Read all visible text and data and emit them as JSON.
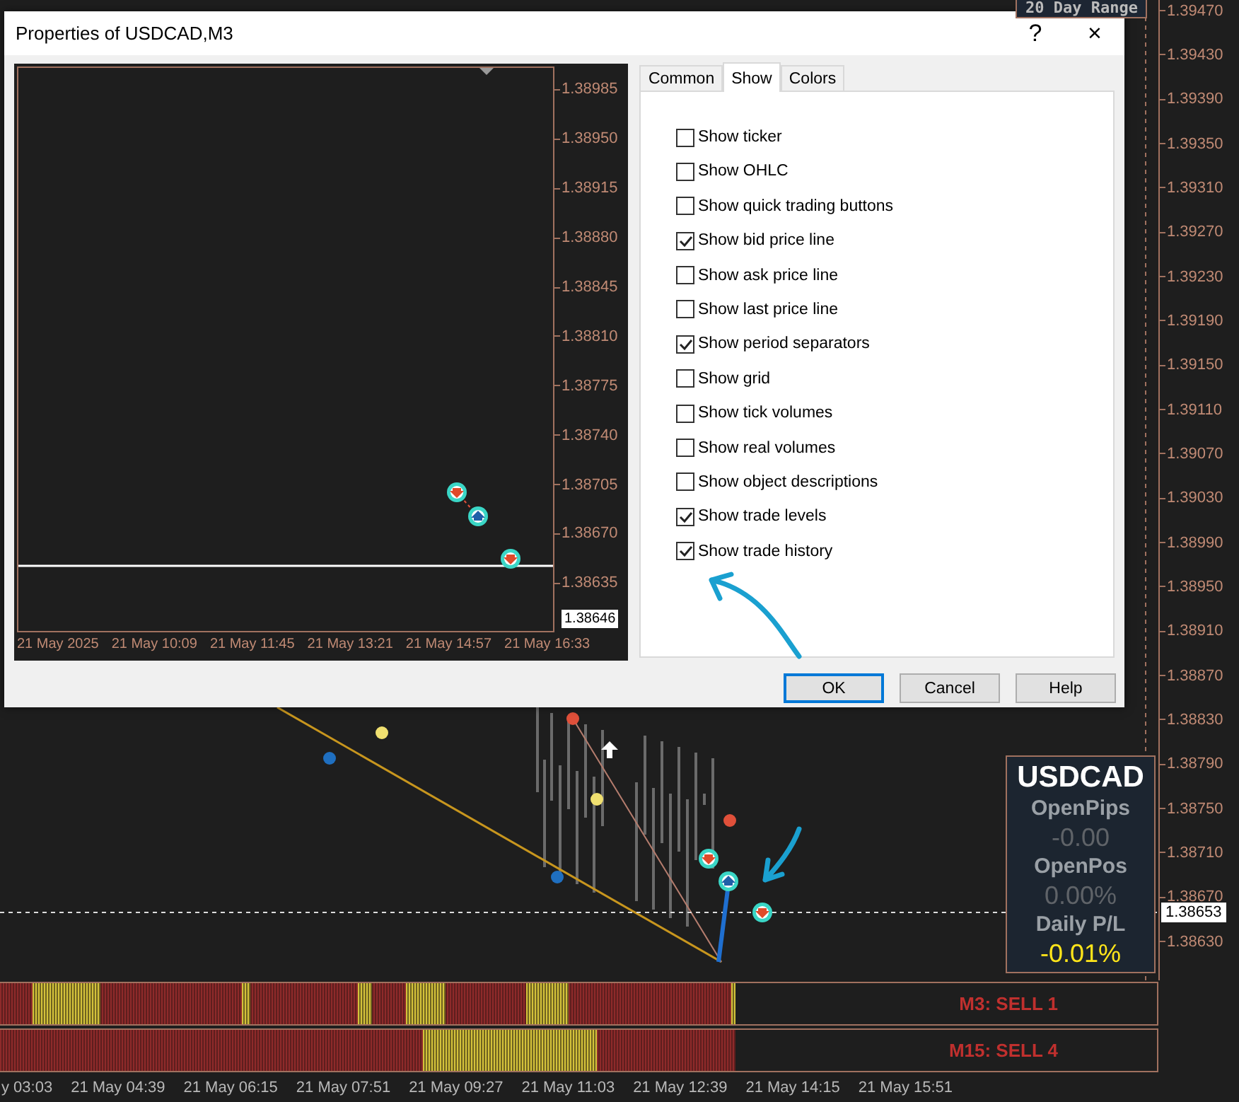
{
  "chart": {
    "top_label": "20 Day Range",
    "price_axis": [
      "1.39470",
      "1.39430",
      "1.39390",
      "1.39350",
      "1.39310",
      "1.39270",
      "1.39230",
      "1.39190",
      "1.39150",
      "1.39110",
      "1.39070",
      "1.39030",
      "1.38990",
      "1.38950",
      "1.38910",
      "1.38870",
      "1.38830",
      "1.38790",
      "1.38750",
      "1.38710",
      "1.38670",
      "1.38630"
    ],
    "current_price": "1.38653",
    "info_panel": [
      {
        "text": "USDCAD",
        "kind": "symbol"
      },
      {
        "text": "OpenPips",
        "kind": "label"
      },
      {
        "text": "-0.00",
        "kind": "muted"
      },
      {
        "text": "OpenPos",
        "kind": "label"
      },
      {
        "text": "0.00%",
        "kind": "muted"
      },
      {
        "text": "Daily P/L",
        "kind": "label"
      },
      {
        "text": "-0.01%",
        "kind": "accent"
      }
    ],
    "signal_strips": [
      {
        "label": "M3: SELL 1"
      },
      {
        "label": "M15: SELL 4"
      }
    ],
    "time_axis": [
      "y 03:03",
      "21 May 04:39",
      "21 May 06:15",
      "21 May 07:51",
      "21 May 09:27",
      "21 May 11:03",
      "21 May 12:39",
      "21 May 14:15",
      "21 May 15:51"
    ]
  },
  "dialog": {
    "title": "Properties of USDCAD,M3",
    "help": "?",
    "close": "×",
    "preview": {
      "price_axis": [
        "1.38985",
        "1.38950",
        "1.38915",
        "1.38880",
        "1.38845",
        "1.38810",
        "1.38775",
        "1.38740",
        "1.38705",
        "1.38670",
        "1.38635"
      ],
      "current_price": "1.38646",
      "time_axis": [
        "21 May 2025",
        "21 May 10:09",
        "21 May 11:45",
        "21 May 13:21",
        "21 May 14:57",
        "21 May 16:33"
      ]
    },
    "tabs": [
      {
        "label": "Common",
        "selected": false
      },
      {
        "label": "Show",
        "selected": true
      },
      {
        "label": "Colors",
        "selected": false
      }
    ],
    "options": [
      {
        "label": "Show ticker",
        "checked": false
      },
      {
        "label": "Show OHLC",
        "checked": false
      },
      {
        "label": "Show quick trading buttons",
        "checked": false
      },
      {
        "label": "Show bid price line",
        "checked": true
      },
      {
        "label": "Show ask price line",
        "checked": false
      },
      {
        "label": "Show last price line",
        "checked": false
      },
      {
        "label": "Show period separators",
        "checked": true
      },
      {
        "label": "Show grid",
        "checked": false
      },
      {
        "label": "Show tick volumes",
        "checked": false
      },
      {
        "label": "Show real volumes",
        "checked": false
      },
      {
        "label": "Show object descriptions",
        "checked": false
      },
      {
        "label": "Show trade levels",
        "checked": true
      },
      {
        "label": "Show trade history",
        "checked": true
      }
    ],
    "buttons": [
      {
        "label": "OK",
        "default": true
      },
      {
        "label": "Cancel",
        "default": false
      },
      {
        "label": "Help",
        "default": false
      }
    ]
  }
}
